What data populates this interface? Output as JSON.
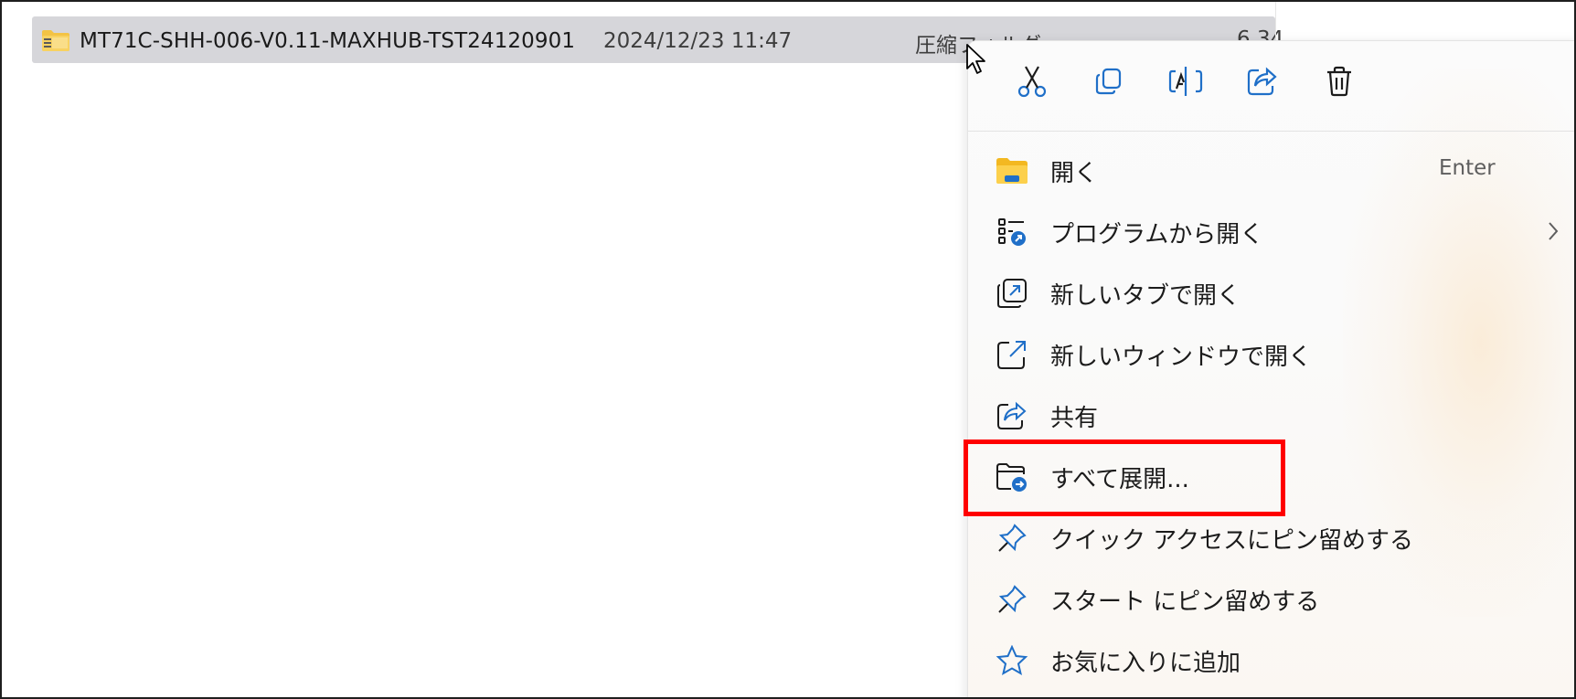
{
  "file": {
    "name": "MT71C-SHH-006-V0.11-MAXHUB-TST24120901",
    "date": "2024/12/23 11:47",
    "type": "圧縮フォルダー",
    "size": "6,34",
    "icon": "zip-folder-icon"
  },
  "context_menu": {
    "toolbar": [
      {
        "name": "cut",
        "icon": "scissors-icon"
      },
      {
        "name": "copy",
        "icon": "copy-icon"
      },
      {
        "name": "rename",
        "icon": "rename-icon"
      },
      {
        "name": "share",
        "icon": "share-icon"
      },
      {
        "name": "delete",
        "icon": "trash-icon"
      }
    ],
    "items": [
      {
        "label": "開く",
        "shortcut": "Enter",
        "icon": "folder-icon"
      },
      {
        "label": "プログラムから開く",
        "submenu": true,
        "icon": "open-with-icon"
      },
      {
        "label": "新しいタブで開く",
        "icon": "new-tab-icon"
      },
      {
        "label": "新しいウィンドウで開く",
        "icon": "new-window-icon"
      },
      {
        "label": "共有",
        "icon": "share-icon"
      },
      {
        "label": "すべて展開...",
        "icon": "extract-all-icon",
        "highlighted": true
      },
      {
        "label": "クイック アクセスにピン留めする",
        "icon": "pin-icon"
      },
      {
        "label": "スタート にピン留めする",
        "icon": "pin-icon"
      },
      {
        "label": "お気に入りに追加",
        "icon": "star-icon"
      }
    ]
  },
  "colors": {
    "selection": "#d6d6da",
    "accent": "#1f6fc8",
    "highlight_border": "#ff0000"
  }
}
